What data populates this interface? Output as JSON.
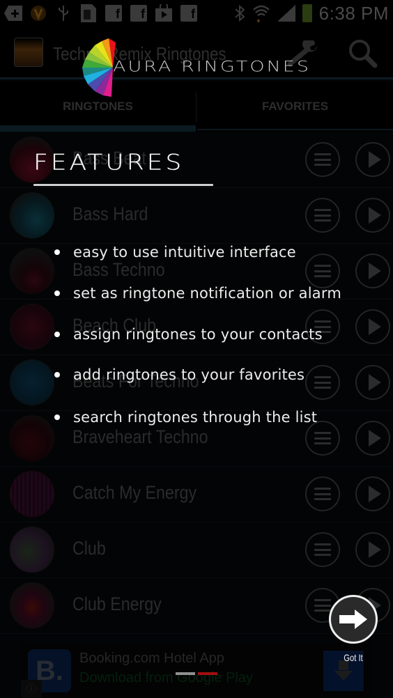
{
  "status_bar": {
    "time": "6:38 PM",
    "icons": [
      "add-notification-icon",
      "vlc-icon",
      "usb-icon",
      "sd-card-icon",
      "facebook-icon",
      "facebook-icon",
      "play-store-icon",
      "facebook-icon",
      "bluetooth-icon",
      "wifi-icon",
      "signal-icon",
      "battery-charging-icon"
    ]
  },
  "action_bar": {
    "title": "Techno Remix Ringtones",
    "settings_icon": "wrench-icon",
    "search_icon": "search-icon"
  },
  "tabs": [
    {
      "label": "RINGTONES",
      "active": true
    },
    {
      "label": "FAVORITES",
      "active": false
    }
  ],
  "ringtones": [
    {
      "title": "Bass Beat",
      "avatar_color": "#5a0a1e"
    },
    {
      "title": "Bass Hard",
      "avatar_color": "#0b3a44"
    },
    {
      "title": "Bass Techno",
      "avatar_color": "#3a0a12"
    },
    {
      "title": "Beach Club",
      "avatar_color": "#3a0610"
    },
    {
      "title": "Beats For Techno",
      "avatar_color": "#07263a"
    },
    {
      "title": "Braveheart Techno",
      "avatar_color": "#2a0508"
    },
    {
      "title": "Catch My Energy",
      "avatar_color": "#260a20"
    },
    {
      "title": "Club",
      "avatar_color": "#1a2218"
    },
    {
      "title": "Club Energy",
      "avatar_color": "#3a0a08"
    }
  ],
  "ad": {
    "title": "Booking.com Hotel App",
    "subtitle": "Download from Google Play",
    "logo_letter": "B."
  },
  "overlay": {
    "brand": "AURA RINGTONES",
    "heading": "FEATURES",
    "features": [
      "easy to use intuitive interface",
      "set as ringtone notification or alarm",
      "assign ringtones to your contacts",
      "add ringtones to your favorites",
      "search ringtones through the list"
    ],
    "next_label": "Got It",
    "page_count": 2,
    "current_page": 2,
    "colors": {
      "pager_inactive": "#8f8f8f",
      "pager_active": "#a10f10"
    }
  }
}
